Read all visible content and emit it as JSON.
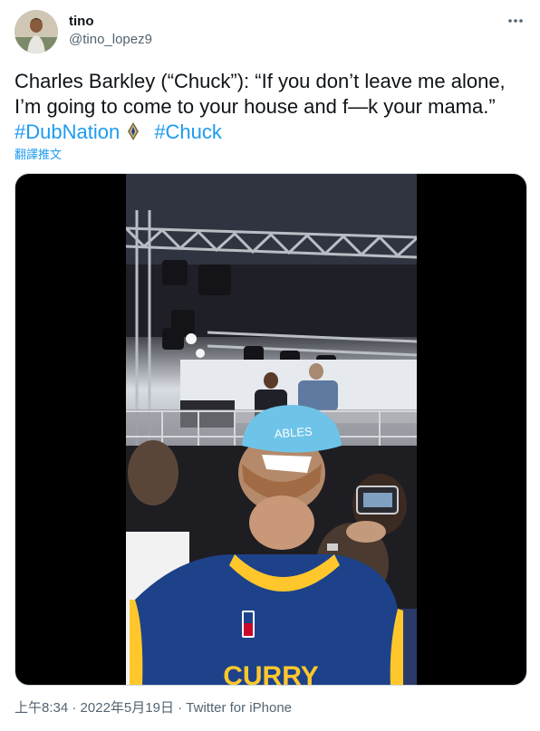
{
  "user": {
    "display_name": "tino",
    "handle": "@tino_lopez9"
  },
  "tweet": {
    "text_main": "Charles Barkley (“Chuck”): “If you don’t leave me alone, I’m going to come to your house and f—k your mama.” ",
    "hashtag_1": "#DubNation",
    "hashtag_2": "#Chuck",
    "emoji_icon": "warriors-trophy-emoji-icon",
    "translate_label": "翻譯推文"
  },
  "media": {
    "type": "video",
    "cap_text": "ABLES",
    "jersey_text": "CURRY"
  },
  "footer": {
    "time": "上午8:34",
    "separator": " · ",
    "date": "2022年5月19日",
    "source": "Twitter for iPhone"
  },
  "colors": {
    "link": "#1d9bf0",
    "secondary_text": "#536471",
    "primary_text": "#0f1419",
    "jersey_blue": "#1d428a",
    "jersey_yellow": "#ffc72c",
    "cap_blue": "#6ec4e8"
  }
}
